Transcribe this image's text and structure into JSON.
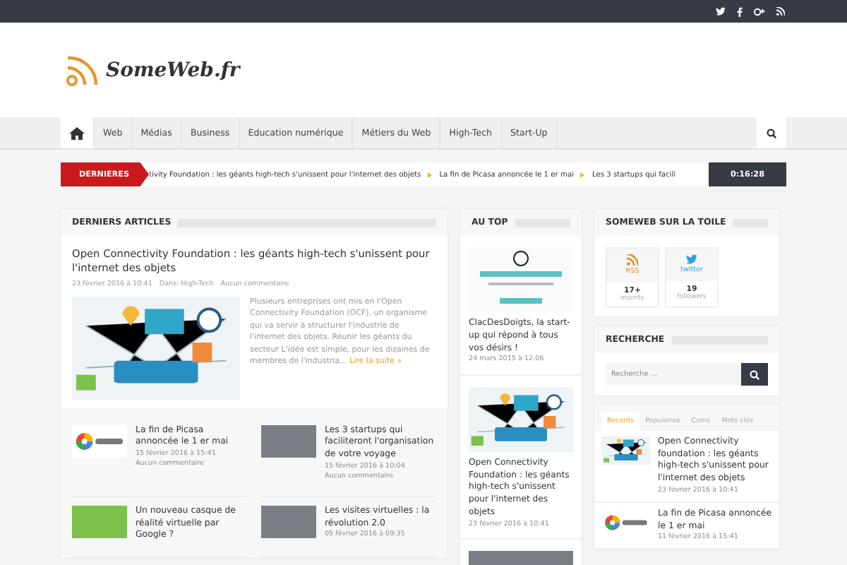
{
  "logo": {
    "text": "SomeWeb.fr"
  },
  "nav": {
    "items": [
      {
        "kind": "home",
        "selected": true
      },
      {
        "kind": "link",
        "label": "Web",
        "selected": false
      },
      {
        "kind": "link",
        "label": "Médias",
        "selected": false
      },
      {
        "kind": "link",
        "label": "Business",
        "selected": false
      },
      {
        "kind": "link",
        "label": "Education numérique",
        "selected": false
      },
      {
        "kind": "link",
        "label": "Métiers du Web",
        "selected": false
      },
      {
        "kind": "link",
        "label": "High-Tech",
        "selected": false
      },
      {
        "kind": "link",
        "label": "Start-Up",
        "selected": false
      }
    ]
  },
  "ticker": {
    "label": "DERNIERES",
    "items": [
      "tivity Foundation : les géants high-tech s'unissent pour l'internet des objets",
      "La fin de Picasa annoncée le 1 er mai",
      "Les 3 startups qui facili"
    ],
    "time": "0:16:28"
  },
  "latest": {
    "title": "DERNIERS ARTICLES",
    "featured": {
      "title": "Open Connectivity Foundation : les géants high-tech s'unissent pour l'internet des objets",
      "date": "23 février 2016 à 10:41",
      "category": "Dans: High-Tech",
      "comments": "Aucun commentaire",
      "excerpt": "Plusieurs entreprises ont mis en l'Open Connectivity Foundation (OCF), un organisme qui va servir à structurer l'industrie de l'internet des objets. Réunir les géants du secteur L'idée est simple, pour les dizaines de membres de l'industria...",
      "more": "Lire la suite »"
    },
    "items": [
      {
        "title": "La fin de Picasa annoncée le 1 er mai",
        "date": "15 février 2016 à 15:41",
        "comments": "Aucun commentaire",
        "kind": "picasa"
      },
      {
        "title": "Les 3 startups qui faciliteront l'organisation de votre voyage",
        "date": "15 février 2016 à 10:04",
        "comments": "Aucun commentaire",
        "kind": "photo"
      },
      {
        "title": "Un nouveau casque de réalité virtuelle par Google ?",
        "kind": "google"
      },
      {
        "title": "Les visites virtuelles : la révolution 2.0",
        "date": "05 février 2016 à 09:35",
        "kind": "photo"
      }
    ]
  },
  "top": {
    "title": "AU TOP",
    "items": [
      {
        "title": "ClacDesDoigts, la start-up qui répond à tous vos désirs !",
        "date": "24 mars 2015 à 12:06",
        "kind": "clac"
      },
      {
        "title": "Open Connectivity Foundation : les géants high-tech s'unissent pour l'internet des objets",
        "date": "23 février 2016 à 10:41",
        "kind": "iot"
      },
      {
        "kind": "photo"
      }
    ]
  },
  "social": {
    "title": "SOMEWEB SUR LA TOILE",
    "cards": [
      {
        "kind": "rss",
        "name": "RSS",
        "count": "17+",
        "unit": "inscrits"
      },
      {
        "kind": "twitter",
        "name": "twitter",
        "count": "19",
        "unit": "followers"
      }
    ]
  },
  "search": {
    "title": "RECHERCHE",
    "placeholder": "Recherche ..."
  },
  "tabs": {
    "tabs": [
      {
        "label": "Recents",
        "selected": true
      },
      {
        "label": "Populaires",
        "selected": false
      },
      {
        "label": "Coms",
        "selected": false
      },
      {
        "label": "Mots clés",
        "selected": false
      }
    ],
    "items": [
      {
        "title": "Open Connectivity foundation : les géants high-tech s'unissent pour l'internet des objets",
        "date": "23 février 2016 à 10:41",
        "kind": "iot"
      },
      {
        "title": "La fin de Picasa annoncée le 1 er mai",
        "date": "11 février 2016 à 15:41",
        "kind": "picasa"
      }
    ]
  }
}
